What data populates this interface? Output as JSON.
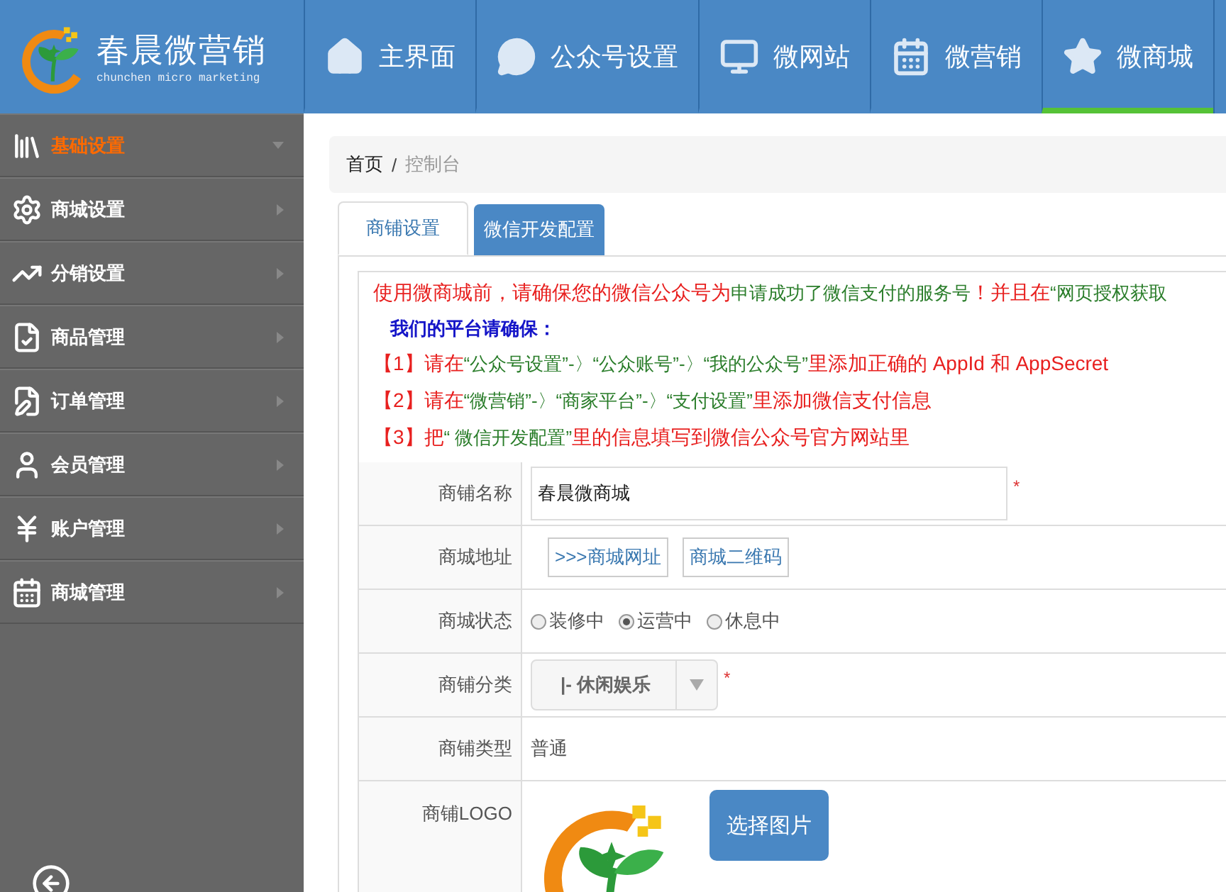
{
  "header": {
    "logo": {
      "name": "春晨微营销",
      "tagline": "chunchen micro marketing"
    },
    "nav": [
      {
        "label": "主界面",
        "selected": false
      },
      {
        "label": "公众号设置",
        "selected": false
      },
      {
        "label": "微网站",
        "selected": false
      },
      {
        "label": "微营销",
        "selected": false
      },
      {
        "label": "微商城",
        "selected": true
      }
    ]
  },
  "sidebar": {
    "items": [
      {
        "label": "基础设置",
        "selected": true
      },
      {
        "label": "商城设置",
        "selected": false
      },
      {
        "label": "分销设置",
        "selected": false
      },
      {
        "label": "商品管理",
        "selected": false
      },
      {
        "label": "订单管理",
        "selected": false
      },
      {
        "label": "会员管理",
        "selected": false
      },
      {
        "label": "账户管理",
        "selected": false
      },
      {
        "label": "商城管理",
        "selected": false
      }
    ]
  },
  "breadcrumb": {
    "separator": "/",
    "items": [
      {
        "label": "首页",
        "current": false
      },
      {
        "label": "控制台",
        "current": true
      }
    ]
  },
  "tabs": [
    {
      "label": "商铺设置",
      "selected": true
    },
    {
      "label": "微信开发配置",
      "selected": false
    }
  ],
  "notice": {
    "lines": [
      {
        "kind": "text",
        "segments": [
          {
            "text": "使用微商城前，请确保您的微信公众号为",
            "color": "#e8201f"
          },
          {
            "text": "申请成功了微信支付的服务号",
            "color": "#2a7d2a"
          },
          {
            "text": "！并且在",
            "color": "#e8201f"
          },
          {
            "text": "“网页授权获取",
            "color": "#2a7d2a"
          }
        ]
      },
      {
        "kind": "heading",
        "segments": [
          {
            "text": "我们的平台请确保：",
            "color": "#1515c8"
          }
        ]
      },
      {
        "kind": "text",
        "segments": [
          {
            "text": "【1】请在",
            "color": "#e8201f"
          },
          {
            "text": "“公众号设置”-〉“公众账号”-〉“我的公众号”",
            "color": "#2a7d2a"
          },
          {
            "text": "里添加正确的 AppId 和 AppSecret",
            "color": "#e8201f"
          }
        ]
      },
      {
        "kind": "text",
        "segments": [
          {
            "text": "【2】请在",
            "color": "#e8201f"
          },
          {
            "text": "“微营销”-〉“商家平台”-〉“支付设置”",
            "color": "#2a7d2a"
          },
          {
            "text": "里添加微信支付信息",
            "color": "#e8201f"
          }
        ]
      },
      {
        "kind": "text",
        "segments": [
          {
            "text": "【3】把",
            "color": "#e8201f"
          },
          {
            "text": "“ 微信开发配置”",
            "color": "#2a7d2a"
          },
          {
            "text": "里的信息填写到微信公众号官方网站里",
            "color": "#e8201f"
          }
        ]
      }
    ]
  },
  "form": {
    "rows": [
      {
        "label": "商铺名称",
        "kind": "input",
        "value": "春晨微商城",
        "mark": "*"
      },
      {
        "label": "商城地址",
        "kind": "links",
        "links": [
          ">>>商城网址",
          "商城二维码"
        ]
      },
      {
        "label": "商城状态",
        "kind": "radio",
        "options": [
          {
            "label": "装修中",
            "selected": false
          },
          {
            "label": "运营中",
            "selected": true
          },
          {
            "label": "休息中",
            "selected": false
          }
        ]
      },
      {
        "label": "商铺分类",
        "kind": "select",
        "value": "|- 休闲娱乐",
        "mark": "*"
      },
      {
        "label": "商铺类型",
        "kind": "text",
        "value": "普通"
      },
      {
        "label": "商铺LOGO",
        "kind": "image",
        "button": "选择图片"
      }
    ]
  }
}
